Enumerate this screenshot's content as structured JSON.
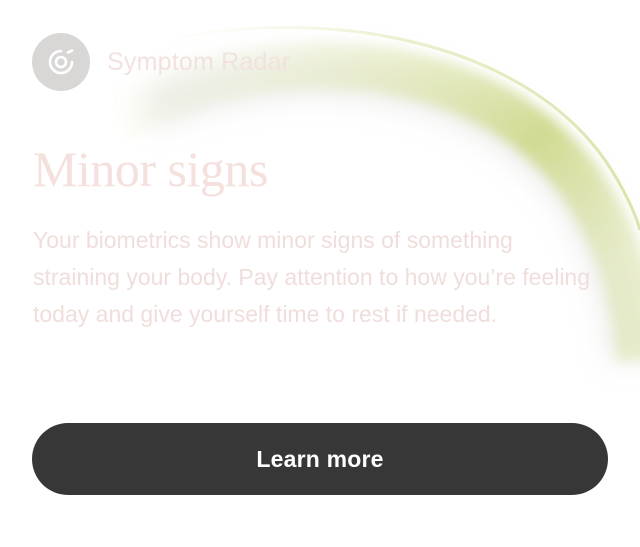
{
  "app": {
    "name": "Symptom Radar",
    "icon": "radar-icon"
  },
  "status": {
    "title": "Minor signs",
    "description": "Your biometrics show minor signs of something straining your body. Pay attention to how you’re feeling today and give yourself time to rest if needed."
  },
  "actions": {
    "learn_more_label": "Learn more"
  },
  "colors": {
    "button_background": "#373737",
    "button_text": "#ffffff",
    "arc_accent": "#d2dc8c",
    "icon_background": "#d9d6d6"
  }
}
